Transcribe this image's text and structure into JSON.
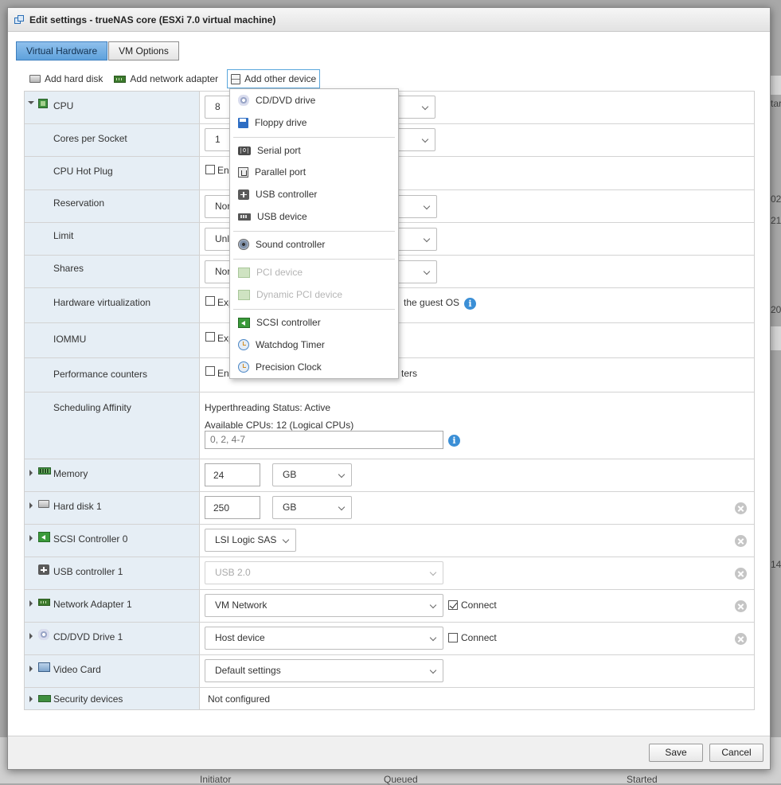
{
  "background": {
    "fragments": [
      "tar",
      "02",
      "21",
      "20",
      "14"
    ],
    "footer_columns": [
      "Initiator",
      "Queued",
      "Started"
    ]
  },
  "dialog": {
    "title": "Edit settings - trueNAS core (ESXi 7.0 virtual machine)",
    "tabs": [
      {
        "label": "Virtual Hardware",
        "active": true
      },
      {
        "label": "VM Options",
        "active": false
      }
    ],
    "toolbar": {
      "add_hard_disk": "Add hard disk",
      "add_network_adapter": "Add network adapter",
      "add_other_device": "Add other device"
    },
    "cpu": {
      "label": "CPU",
      "value": "8",
      "cores_per_socket": {
        "label": "Cores per Socket",
        "value": "1"
      },
      "hot_plug": {
        "label": "CPU Hot Plug",
        "text": "En"
      },
      "reservation": {
        "label": "Reservation",
        "value": "Nor"
      },
      "limit": {
        "label": "Limit",
        "value": "Unli"
      },
      "shares": {
        "label": "Shares",
        "value": "Nor"
      },
      "hw_virt": {
        "label": "Hardware virtualization",
        "text_start": "Exp",
        "text_end": "the guest OS"
      },
      "iommu": {
        "label": "IOMMU",
        "text": "Exp"
      },
      "perf_counters": {
        "label": "Performance counters",
        "text_start": "En",
        "text_end": "ters"
      },
      "sched_affinity": {
        "label": "Scheduling Affinity",
        "ht_status": "Hyperthreading Status: Active",
        "available": "Available CPUs: 12 (Logical CPUs)",
        "placeholder": "0, 2, 4-7"
      }
    },
    "devices": [
      {
        "id": "memory",
        "label": "Memory",
        "value": "24",
        "unit": "GB"
      },
      {
        "id": "hdd",
        "label": "Hard disk 1",
        "value": "250",
        "unit": "GB"
      },
      {
        "id": "scsi",
        "label": "SCSI Controller 0",
        "value": "LSI Logic SAS"
      },
      {
        "id": "usb",
        "label": "USB controller 1",
        "value": "USB 2.0"
      },
      {
        "id": "nic",
        "label": "Network Adapter 1",
        "value": "VM Network",
        "connect_label": "Connect",
        "connected": true
      },
      {
        "id": "cd",
        "label": "CD/DVD Drive 1",
        "value": "Host device",
        "connect_label": "Connect",
        "connected": false
      },
      {
        "id": "video",
        "label": "Video Card",
        "value": "Default settings"
      },
      {
        "id": "security",
        "label": "Security devices",
        "value": "Not configured"
      }
    ],
    "menu": [
      {
        "label": "CD/DVD drive",
        "icon": "cd-icon",
        "enabled": true
      },
      {
        "label": "Floppy drive",
        "icon": "floppy-icon",
        "enabled": true
      },
      {
        "label": "Serial port",
        "icon": "serial-port-icon",
        "enabled": true
      },
      {
        "label": "Parallel port",
        "icon": "parallel-port-icon",
        "enabled": true
      },
      {
        "label": "USB controller",
        "icon": "usb-controller-icon",
        "enabled": true
      },
      {
        "label": "USB device",
        "icon": "usb-device-icon",
        "enabled": true
      },
      {
        "label": "Sound controller",
        "icon": "sound-icon",
        "enabled": true
      },
      {
        "label": "PCI device",
        "icon": "pci-icon",
        "enabled": false
      },
      {
        "label": "Dynamic PCI device",
        "icon": "pci-icon",
        "enabled": false
      },
      {
        "label": "SCSI controller",
        "icon": "scsi-icon",
        "enabled": true
      },
      {
        "label": "Watchdog Timer",
        "icon": "clock-icon",
        "enabled": true
      },
      {
        "label": "Precision Clock",
        "icon": "clock-icon",
        "enabled": true
      }
    ],
    "buttons": {
      "save": "Save",
      "cancel": "Cancel"
    }
  }
}
